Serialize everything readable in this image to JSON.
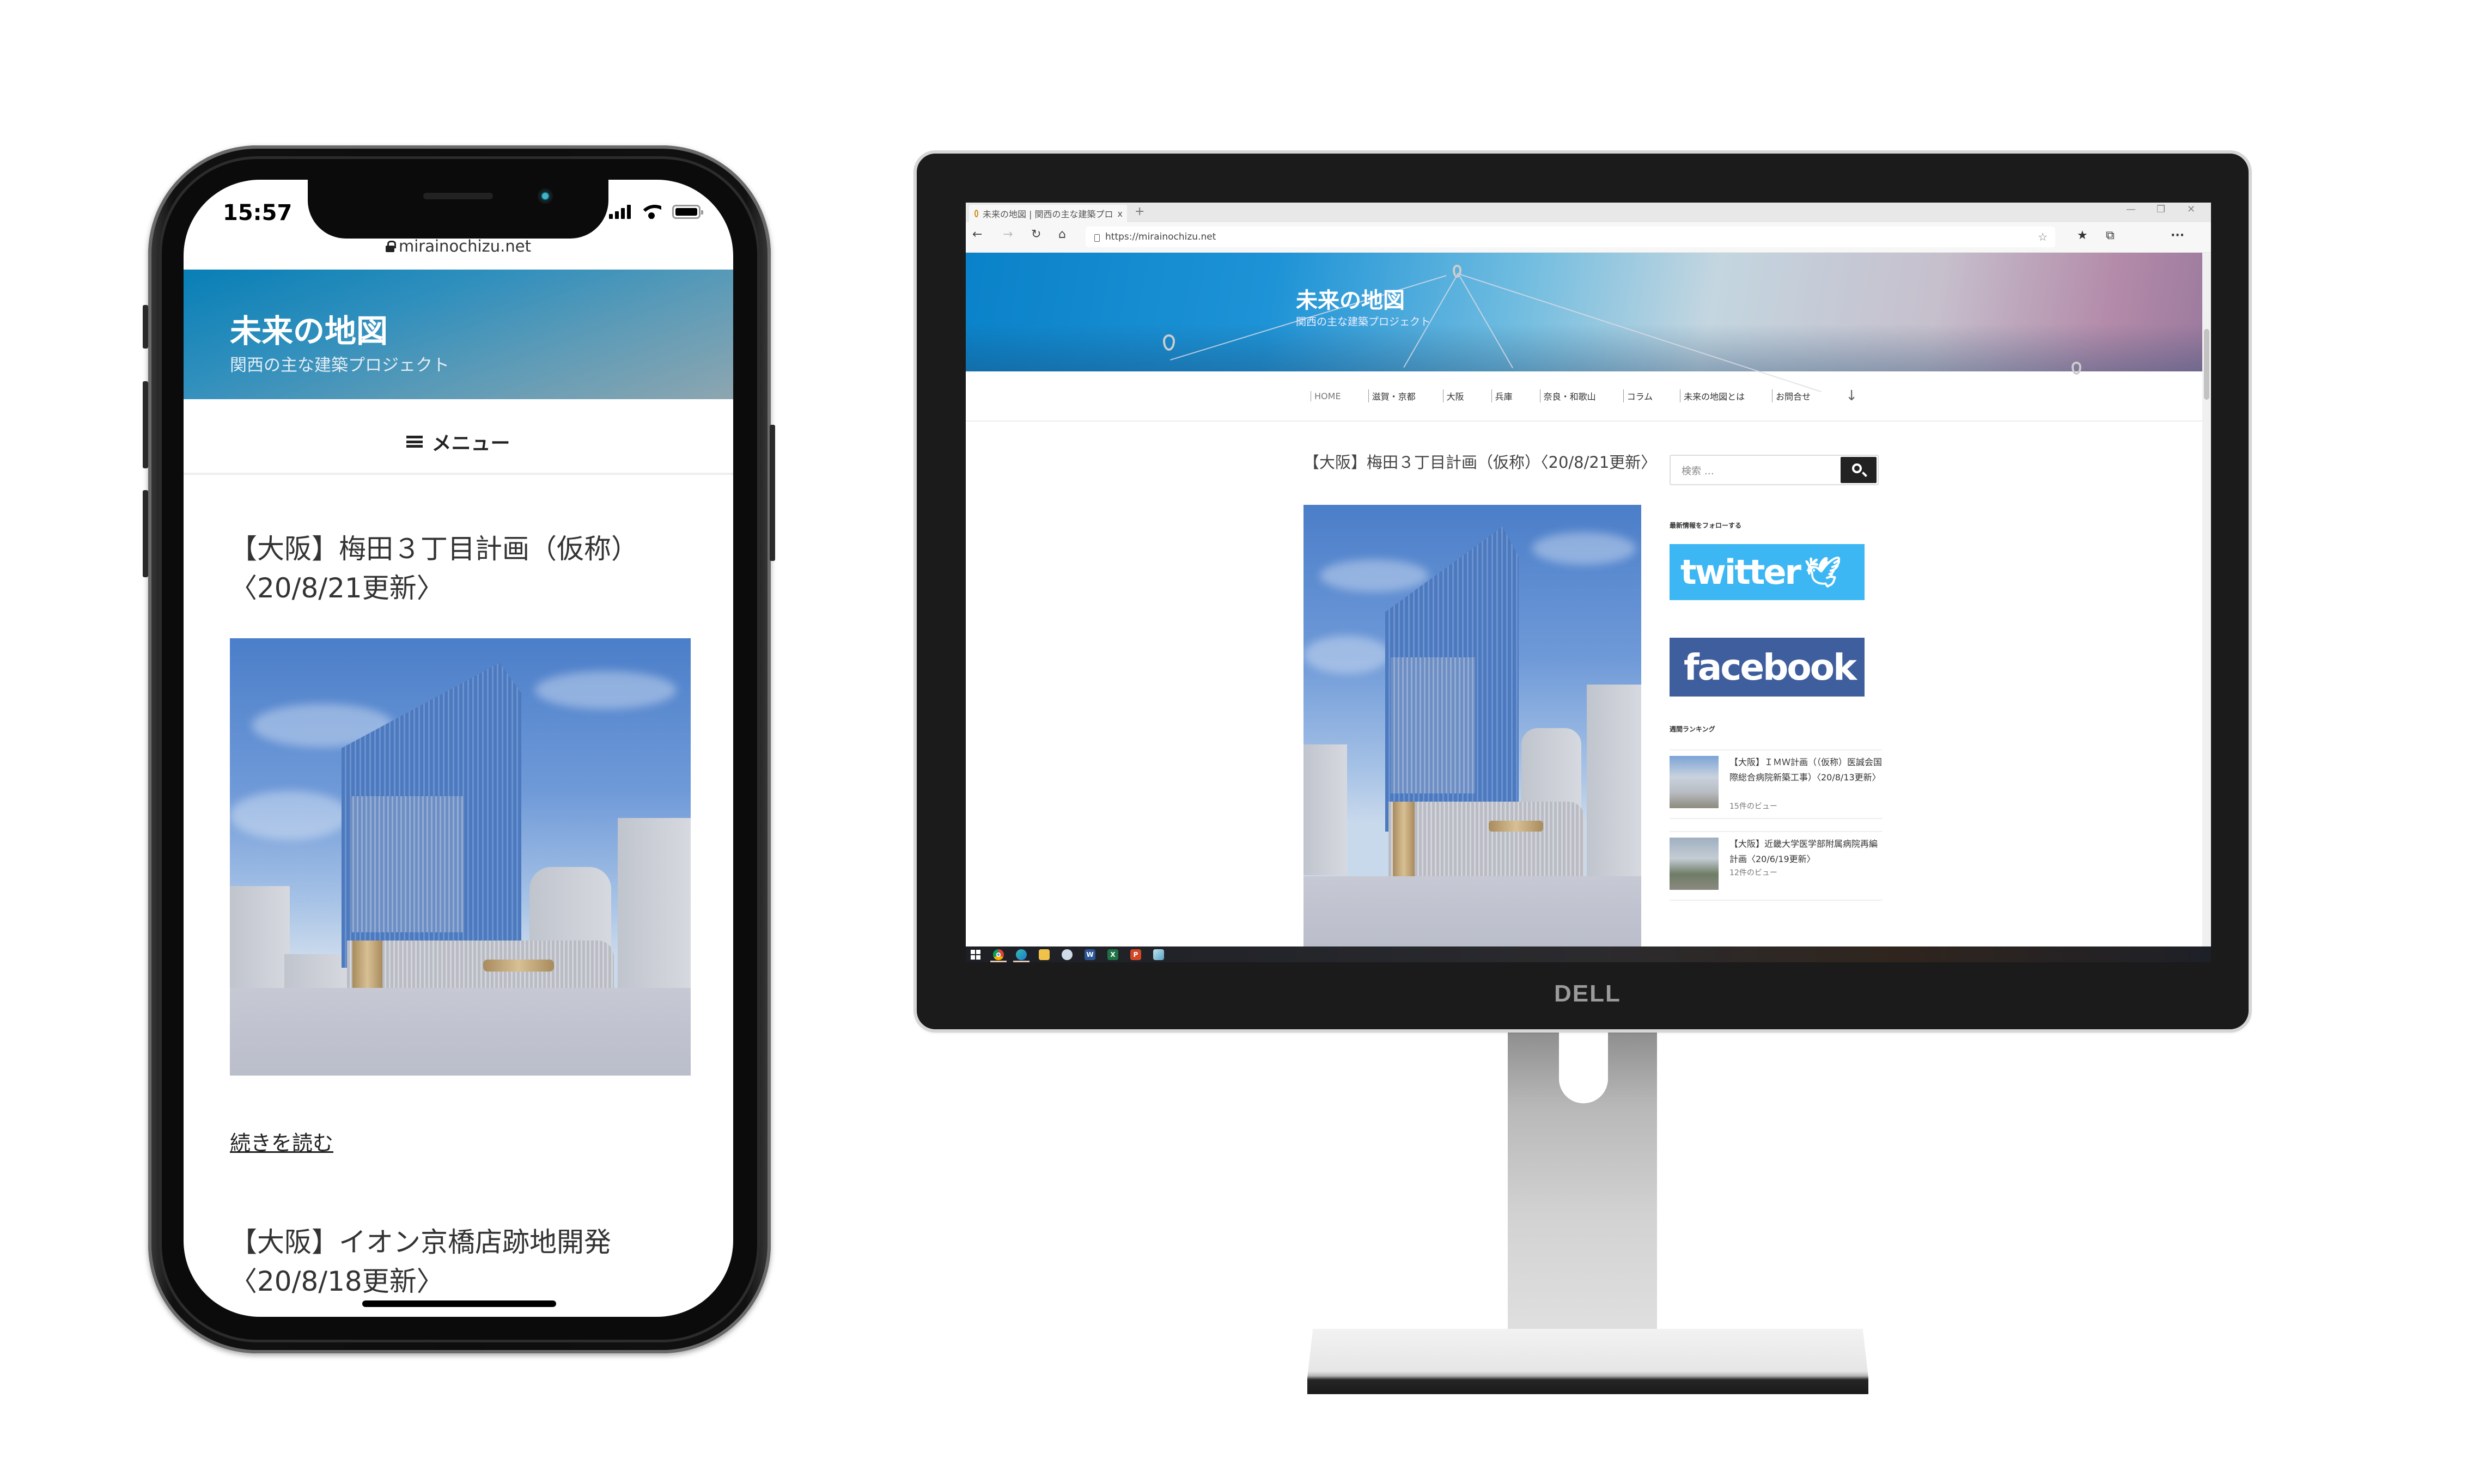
{
  "phone": {
    "status_time": "15:57",
    "url": "mirainochizu.net",
    "site_title": "未来の地図",
    "site_subtitle": "関西の主な建築プロジェクト",
    "menu_label": "メニュー",
    "posts": [
      {
        "title_line1": "【大阪】梅田３丁目計画（仮称）",
        "title_line2": "〈20/8/21更新〉"
      },
      {
        "title_line1": "【大阪】イオン京橋店跡地開発",
        "title_line2": "〈20/8/18更新〉"
      }
    ],
    "read_more": "続きを読む"
  },
  "desktop": {
    "tab_title": "未来の地図 | 関西の主な建築プロ",
    "tab_close": "x",
    "new_tab": "+",
    "url": "https://mirainochizu.net",
    "window_controls": {
      "minimize": "—",
      "restore": "❐",
      "close": "✕"
    },
    "toolbar_icons": {
      "back": "←",
      "forward": "→",
      "refresh": "↻",
      "home": "⌂",
      "favorite_add": "☆",
      "favorites": "★",
      "collections": "⧉",
      "more": "···"
    },
    "site_title": "未来の地図",
    "site_subtitle": "関西の主な建築プロジェクト",
    "nav": [
      "HOME",
      "滋賀・京都",
      "大阪",
      "兵庫",
      "奈良・和歌山",
      "コラム",
      "未来の地図とは",
      "お問合せ"
    ],
    "nav_arrow": "↓",
    "post_title": "【大阪】梅田３丁目計画（仮称）〈20/8/21更新〉",
    "search_placeholder": "検索 …",
    "follow_label": "最新情報をフォローする",
    "twitter_label": "twitter",
    "facebook_label": "facebook",
    "ranking_label": "週間ランキング",
    "ranking": [
      {
        "title": "【大阪】ＩＭＷ計画（（仮称）医誠会国際総合病院新築工事）〈20/8/13更新〉",
        "views": "15件のビュー"
      },
      {
        "title": "【大阪】近畿大学医学部附属病院再編計画〈20/6/19更新〉",
        "views": "12件のビュー"
      }
    ],
    "taskbar_apps": [
      "start",
      "chrome",
      "edge",
      "file-explorer",
      "paint",
      "word",
      "excel",
      "powerpoint",
      "notepad"
    ],
    "taskbar_labels": {
      "word": "W",
      "excel": "X",
      "powerpoint": "P"
    }
  },
  "monitor_brand": "DELL",
  "colors": {
    "twitter": "#3cb7f3",
    "facebook": "#3f5e9d",
    "header_blue": "#087fb6"
  }
}
